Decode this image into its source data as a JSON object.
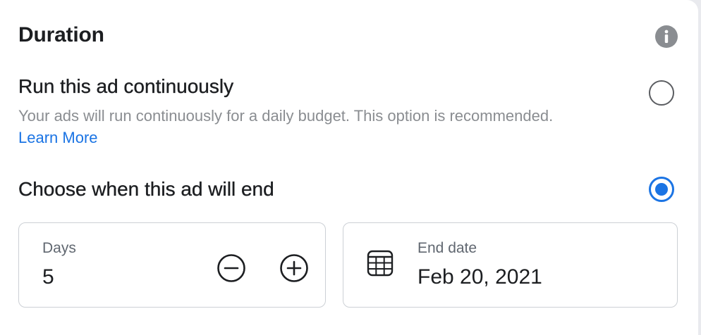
{
  "section": {
    "title": "Duration",
    "info_icon": "info-icon"
  },
  "option_continuous": {
    "title": "Run this ad continuously",
    "description": "Your ads will run continuously for a daily budget. This option is recommended.",
    "link_text": "Learn More",
    "selected": false
  },
  "option_end": {
    "title": "Choose when this ad will end",
    "selected": true
  },
  "days_field": {
    "label": "Days",
    "value": "5",
    "decrement_icon": "minus-circle-icon",
    "increment_icon": "plus-circle-icon"
  },
  "end_date_field": {
    "label": "End date",
    "value": "Feb 20, 2021",
    "icon": "calendar-icon"
  },
  "colors": {
    "accent": "#1b74e4",
    "text_primary": "#1c1e21",
    "text_secondary": "#8a8d91",
    "border": "#ccd0d5",
    "info_icon_bg": "#8a8d91"
  }
}
